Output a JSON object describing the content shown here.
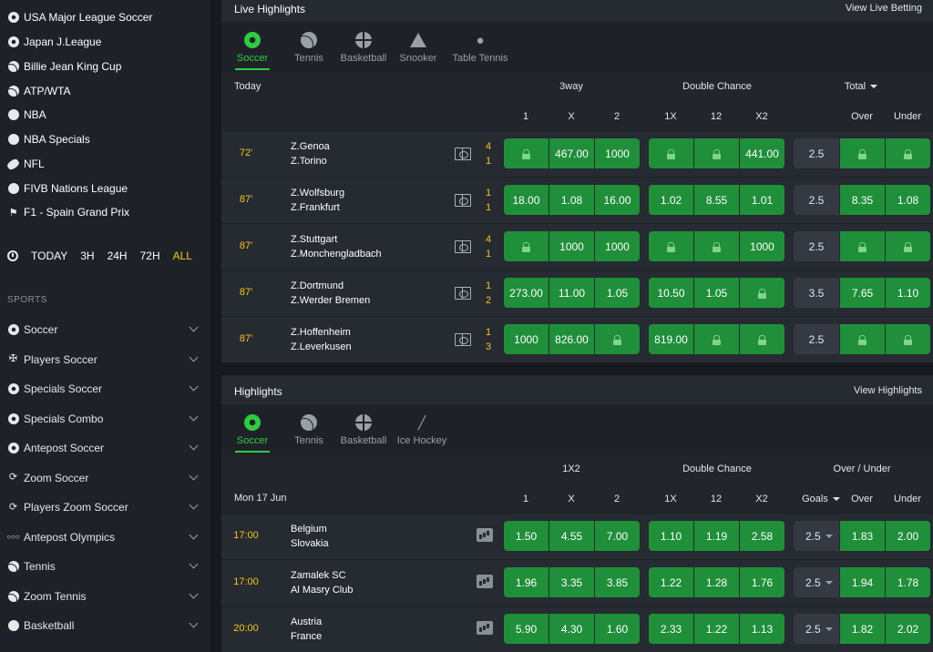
{
  "sidebar": {
    "favorites": [
      {
        "label": "USA Major League Soccer",
        "icon": "soccer-ball-icon"
      },
      {
        "label": "Japan J.League",
        "icon": "soccer-ball-icon"
      },
      {
        "label": "Billie Jean King Cup",
        "icon": "tennis-ball-icon"
      },
      {
        "label": "ATP/WTA",
        "icon": "tennis-ball-icon"
      },
      {
        "label": "NBA",
        "icon": "basketball-icon"
      },
      {
        "label": "NBA Specials",
        "icon": "basketball-icon"
      },
      {
        "label": "NFL",
        "icon": "american-football-icon"
      },
      {
        "label": "FIVB Nations League",
        "icon": "volleyball-icon"
      },
      {
        "label": "F1 - Spain Grand Prix",
        "icon": "motorsport-icon"
      }
    ],
    "time_filter": {
      "options": [
        "TODAY",
        "3H",
        "24H",
        "72H",
        "ALL"
      ],
      "active": "ALL",
      "active_color": "#f5c518"
    },
    "sports_heading": "SPORTS",
    "sports": [
      {
        "label": "Soccer",
        "icon": "soccer-ball-icon"
      },
      {
        "label": "Players Soccer",
        "icon": "player-icon"
      },
      {
        "label": "Specials Soccer",
        "icon": "soccer-ball-icon"
      },
      {
        "label": "Specials Combo",
        "icon": "soccer-ball-icon"
      },
      {
        "label": "Antepost Soccer",
        "icon": "soccer-ball-icon"
      },
      {
        "label": "Zoom Soccer",
        "icon": "zoom-soccer-icon"
      },
      {
        "label": "Players Zoom Soccer",
        "icon": "zoom-soccer-icon"
      },
      {
        "label": "Antepost Olympics",
        "icon": "olympic-rings-icon"
      },
      {
        "label": "Tennis",
        "icon": "tennis-ball-icon"
      },
      {
        "label": "Zoom Tennis",
        "icon": "tennis-ball-icon"
      },
      {
        "label": "Basketball",
        "icon": "basketball-icon"
      }
    ]
  },
  "live": {
    "title": "Live Highlights",
    "view_link": "View Live Betting",
    "tabs": [
      {
        "label": "Soccer",
        "icon": "soccer-ball-icon",
        "active": true
      },
      {
        "label": "Tennis",
        "icon": "tennis-ball-icon",
        "active": false
      },
      {
        "label": "Basketball",
        "icon": "basketball-icon",
        "active": false
      },
      {
        "label": "Snooker",
        "icon": "snooker-triangle-icon",
        "active": false
      },
      {
        "label": "Table Tennis",
        "icon": "table-tennis-icon",
        "active": false
      }
    ],
    "date_label": "Today",
    "group_headers": {
      "threeway": "3way",
      "double_chance": "Double Chance",
      "total": "Total"
    },
    "columns": [
      "1",
      "X",
      "2",
      "1X",
      "12",
      "X2",
      "Over",
      "Under"
    ],
    "matches": [
      {
        "time": "72'",
        "team1": "Z.Genoa",
        "team2": "Z.Torino",
        "score1": "4",
        "score2": "1",
        "odds": [
          "LOCK",
          "467.00",
          "1000",
          "LOCK",
          "LOCK",
          "441.00"
        ],
        "line": "2.5",
        "ou": [
          "LOCK",
          "LOCK"
        ]
      },
      {
        "time": "87'",
        "team1": "Z.Wolfsburg",
        "team2": "Z.Frankfurt",
        "score1": "1",
        "score2": "1",
        "odds": [
          "18.00",
          "1.08",
          "16.00",
          "1.02",
          "8.55",
          "1.01"
        ],
        "line": "2.5",
        "ou": [
          "8.35",
          "1.08"
        ]
      },
      {
        "time": "87'",
        "team1": "Z.Stuttgart",
        "team2": "Z.Monchengladbach",
        "score1": "4",
        "score2": "1",
        "odds": [
          "LOCK",
          "1000",
          "1000",
          "LOCK",
          "LOCK",
          "1000"
        ],
        "line": "2.5",
        "ou": [
          "LOCK",
          "LOCK"
        ]
      },
      {
        "time": "87'",
        "team1": "Z.Dortmund",
        "team2": "Z.Werder Bremen",
        "score1": "1",
        "score2": "2",
        "odds": [
          "273.00",
          "11.00",
          "1.05",
          "10.50",
          "1.05",
          "LOCK"
        ],
        "line": "3.5",
        "ou": [
          "7.65",
          "1.10"
        ]
      },
      {
        "time": "87'",
        "team1": "Z.Hoffenheim",
        "team2": "Z.Leverkusen",
        "score1": "1",
        "score2": "3",
        "odds": [
          "1000",
          "826.00",
          "LOCK",
          "819.00",
          "LOCK",
          "LOCK"
        ],
        "line": "2.5",
        "ou": [
          "LOCK",
          "LOCK"
        ]
      }
    ]
  },
  "highlights": {
    "title": "Highlights",
    "view_link": "View Highlights",
    "tabs": [
      {
        "label": "Soccer",
        "icon": "soccer-ball-icon",
        "active": true
      },
      {
        "label": "Tennis",
        "icon": "tennis-ball-icon",
        "active": false
      },
      {
        "label": "Basketball",
        "icon": "basketball-icon",
        "active": false
      },
      {
        "label": "Ice Hockey",
        "icon": "ice-hockey-icon",
        "active": false
      }
    ],
    "date_label": "Mon 17 Jun",
    "group_headers": {
      "onex2": "1X2",
      "double_chance": "Double Chance",
      "over_under": "Over / Under"
    },
    "columns": [
      "1",
      "X",
      "2",
      "1X",
      "12",
      "X2",
      "Goals",
      "Over",
      "Under"
    ],
    "matches": [
      {
        "time": "17:00",
        "team1": "Belgium",
        "team2": "Slovakia",
        "odds": [
          "1.50",
          "4.55",
          "7.00",
          "1.10",
          "1.19",
          "2.58"
        ],
        "line": "2.5",
        "ou": [
          "1.83",
          "2.00"
        ]
      },
      {
        "time": "17:00",
        "team1": "Zamalek SC",
        "team2": "Al Masry Club",
        "odds": [
          "1.96",
          "3.35",
          "3.85",
          "1.22",
          "1.28",
          "1.76"
        ],
        "line": "2.5",
        "ou": [
          "1.94",
          "1.78"
        ]
      },
      {
        "time": "20:00",
        "team1": "Austria",
        "team2": "France",
        "odds": [
          "5.90",
          "4.30",
          "1.60",
          "2.33",
          "1.22",
          "1.13"
        ],
        "line": "2.5",
        "ou": [
          "1.82",
          "2.02"
        ]
      }
    ]
  },
  "colors": {
    "odds_green": "#1f8f3a",
    "accent_green": "#2ecc40",
    "time_yellow": "#f5c518"
  }
}
